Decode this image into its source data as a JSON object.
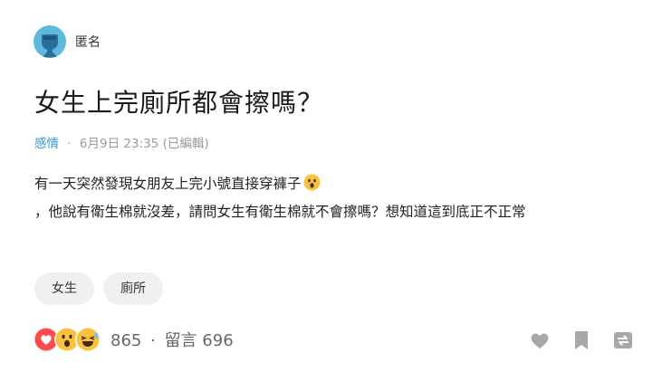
{
  "author": {
    "name": "匿名",
    "avatar_icon": "anonymous-user-icon",
    "avatar_color": "#5fb9df"
  },
  "post": {
    "title": "女生上完廁所都會擦嗎？",
    "board": "感情",
    "separator": "·",
    "datetime": "6月9日 23:35",
    "edited": "(已編輯)",
    "body_line1": "有一天突然發現女朋友上完小號直接穿褲子",
    "body_emoji": "surprised-face-emoji",
    "body_line2": "，他說有衛生棉就沒差，請問女生有衛生棉就不會擦嗎？想知道這到底正不正常"
  },
  "tags": [
    "女生",
    "廁所"
  ],
  "stats": {
    "reactions": [
      "heart-reaction-icon",
      "surprised-reaction-icon",
      "laughing-reaction-icon"
    ],
    "likes": "865",
    "separator": "·",
    "comments_label": "留言",
    "comments": "696"
  },
  "actions": [
    "like-heart-icon",
    "bookmark-icon",
    "share-icon"
  ],
  "colors": {
    "accent": "#3397cf",
    "icon_gray": "#a8a8a8",
    "heart": "#ff4b4b",
    "emoji_yellow": "#f9c23c"
  }
}
